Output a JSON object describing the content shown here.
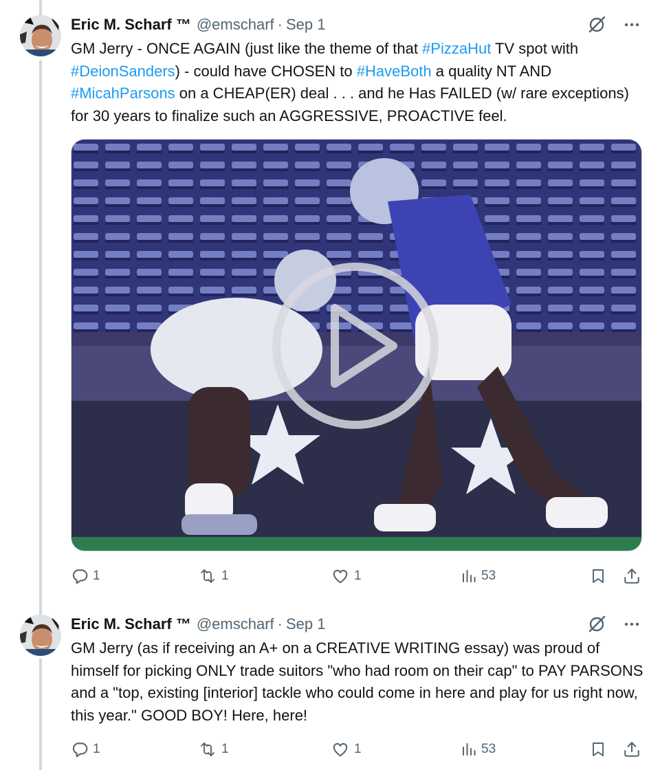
{
  "tweets": [
    {
      "author_name": "Eric M. Scharf ™",
      "handle": "@emscharf",
      "separator": "·",
      "date": "Sep 1",
      "text_parts": [
        "GM Jerry - ONCE AGAIN (just like the theme of that ",
        "#PizzaHut",
        " TV spot with ",
        "#DeionSanders",
        ") - could have CHOSEN to ",
        "#HaveBoth",
        " a quality NT AND ",
        "#MicahParsons",
        " on a CHEAP(ER) deal . . . and he Has FAILED (w/ rare exceptions) for 30 years to finalize such an AGGRESSIVE, PROACTIVE feel."
      ],
      "media": {
        "type": "video",
        "play_icon": "play-icon"
      },
      "replies": "1",
      "reposts": "1",
      "likes": "1",
      "views": "53"
    },
    {
      "author_name": "Eric M. Scharf ™",
      "handle": "@emscharf",
      "separator": "·",
      "date": "Sep 1",
      "text": "GM Jerry (as if receiving an A+ on a CREATIVE WRITING essay) was proud of himself for picking ONLY trade suitors \"who had room on their cap\" to PAY PARSONS and a \"top, existing [interior] tackle who could come in here and play for us right now, this year.\" GOOD BOY! Here, here!",
      "replies": "1",
      "reposts": "1",
      "likes": "1",
      "views": "53"
    }
  ],
  "colors": {
    "text": "#0f1419",
    "secondary": "#536471",
    "link": "#1d9bf0",
    "thread_line": "#cfd9de"
  },
  "icons": [
    "grok-slash-icon",
    "more-icon",
    "reply-icon",
    "repost-icon",
    "like-icon",
    "views-icon",
    "bookmark-icon",
    "share-icon"
  ]
}
